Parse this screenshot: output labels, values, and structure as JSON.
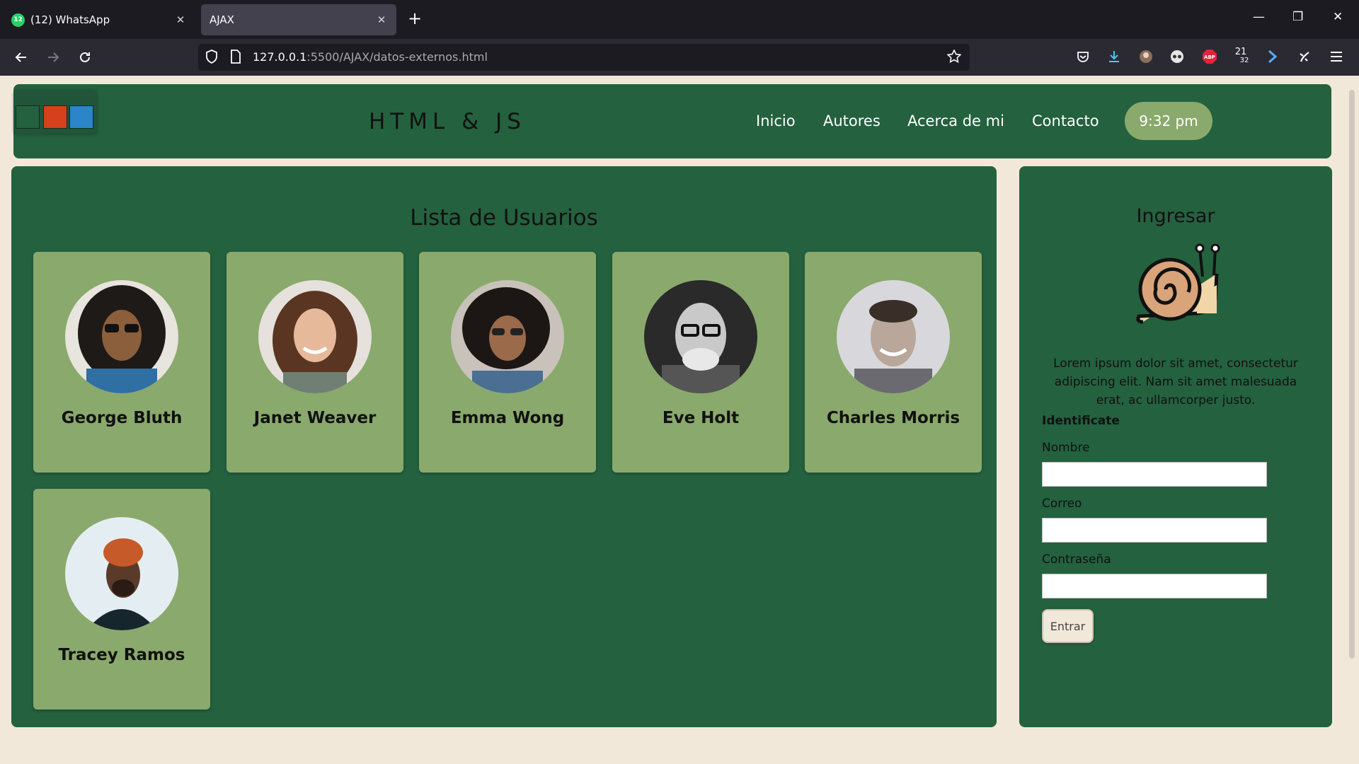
{
  "browser": {
    "tabs": [
      {
        "title": "(12) WhatsApp",
        "badge": "12",
        "close": "✕"
      },
      {
        "title": "AJAX",
        "close": "✕"
      }
    ],
    "new_tab": "+",
    "window_controls": {
      "minimize": "—",
      "restore": "❐",
      "close": "✕"
    },
    "url": {
      "host": "127.0.0.1",
      "path": ":5500/AJAX/datos-externos.html"
    },
    "extensions": {
      "abp": "ABP",
      "counter_top": "21",
      "counter_bottom": "32"
    }
  },
  "header": {
    "theme_colors": [
      "#24613f",
      "#d6401d",
      "#2a86c9"
    ],
    "brand": "HTML & JS",
    "menu": [
      {
        "label": "Inicio"
      },
      {
        "label": "Autores"
      },
      {
        "label": "Acerca de mi"
      },
      {
        "label": "Contacto"
      }
    ],
    "clock": "9:32 pm"
  },
  "main": {
    "title": "Lista de Usuarios",
    "users": [
      {
        "name": "George Bluth"
      },
      {
        "name": "Janet Weaver"
      },
      {
        "name": "Emma Wong"
      },
      {
        "name": "Eve Holt"
      },
      {
        "name": "Charles Morris"
      },
      {
        "name": "Tracey Ramos"
      }
    ]
  },
  "sidebar": {
    "title": "Ingresar",
    "description": "Lorem ipsum dolor sit amet, consectetur adipiscing elit. Nam sit amet malesuada erat, ac ullamcorper justo.",
    "form_heading": "Identificate",
    "fields": [
      {
        "label": "Nombre",
        "value": ""
      },
      {
        "label": "Correo",
        "value": ""
      },
      {
        "label": "Contraseña",
        "value": ""
      }
    ],
    "submit_label": "Entrar"
  },
  "colors": {
    "panel": "#24613f",
    "card": "#8aa96c",
    "page_bg": "#f2e8da"
  }
}
